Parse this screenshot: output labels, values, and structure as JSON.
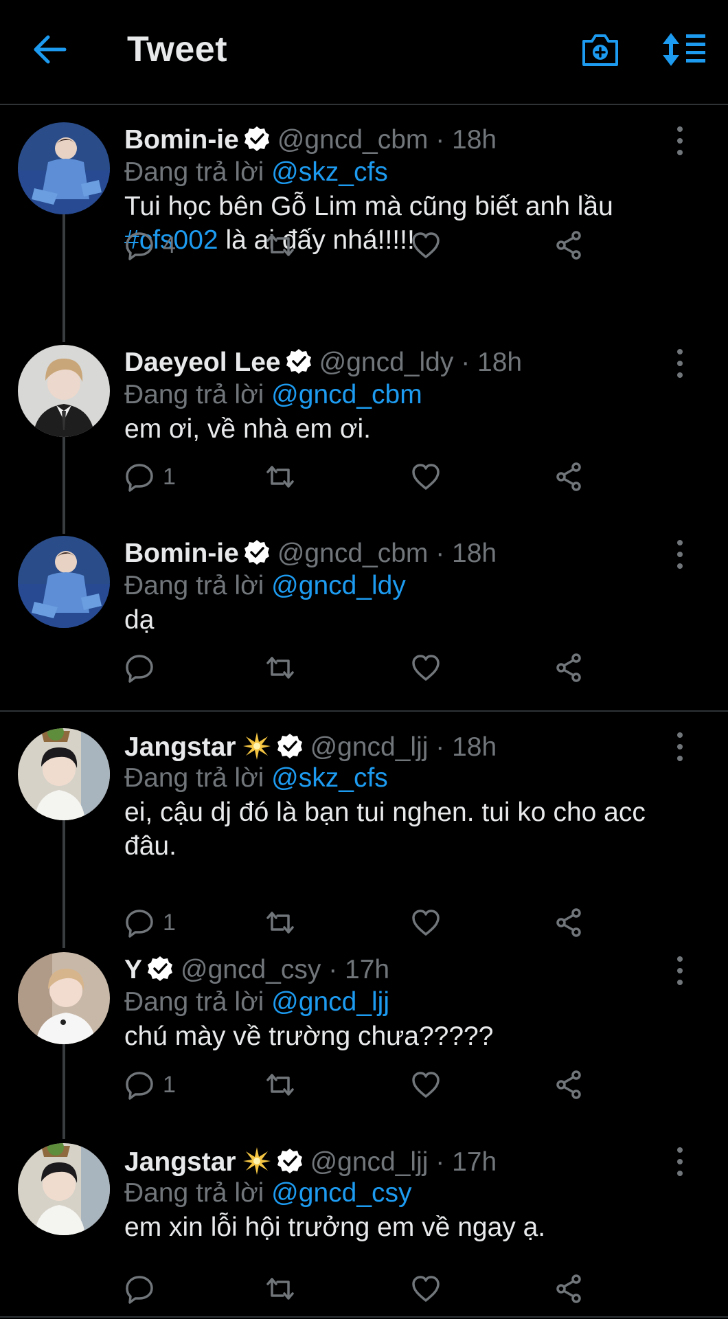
{
  "header": {
    "title": "Tweet"
  },
  "tweets": [
    {
      "name": "Bomin-ie",
      "handle": "@gncd_cbm",
      "time": "· 18h",
      "replying_prefix": "Đang trả lời ",
      "replying_to": "@skz_cfs",
      "text_part1": "Tui học bên Gỗ Lim mà cũng biết anh lầu ",
      "hashtag": "#cfs002",
      "text_part2": " là ai đấy nhá!!!!!",
      "reply_count": "4"
    },
    {
      "name": "Daeyeol Lee",
      "handle": "@gncd_ldy",
      "time": "· 18h",
      "replying_prefix": "Đang trả lời ",
      "replying_to": "@gncd_cbm",
      "text": "em ơi, về nhà em ơi.",
      "reply_count": "1"
    },
    {
      "name": "Bomin-ie",
      "handle": "@gncd_cbm",
      "time": "· 18h",
      "replying_prefix": "Đang trả lời ",
      "replying_to": "@gncd_ldy",
      "text": "dạ",
      "reply_count": ""
    },
    {
      "name": "Jangstar",
      "handle": "@gncd_ljj",
      "time": "· 18h",
      "replying_prefix": "Đang trả lời ",
      "replying_to": "@skz_cfs",
      "text": "ei, cậu dj đó là bạn tui nghen. tui ko cho acc đâu.",
      "reply_count": "1"
    },
    {
      "name": "Y",
      "handle": "@gncd_csy",
      "time": "· 17h",
      "replying_prefix": "Đang trả lời ",
      "replying_to": "@gncd_ljj",
      "text": "chú mày về trường chưa?????",
      "reply_count": "1"
    },
    {
      "name": "Jangstar",
      "handle": "@gncd_ljj",
      "time": "· 17h",
      "replying_prefix": "Đang trả lời ",
      "replying_to": "@gncd_csy",
      "text": "em xin lỗi hội trưởng em về ngay ạ.",
      "reply_count": ""
    }
  ],
  "icons": {
    "back": "back-arrow-icon",
    "camera": "camera-plus-icon",
    "sort": "sort-icon",
    "verified": "verified-badge-icon",
    "sparkle": "sparkle-star-icon",
    "reply": "reply-icon",
    "retweet": "retweet-icon",
    "like": "heart-icon",
    "share": "share-icon",
    "more": "more-vertical-icon"
  },
  "colors": {
    "accent": "#1d9bf0",
    "background": "#000000",
    "muted": "#71767b",
    "text": "#e7e9ea",
    "divider": "#2f3336"
  }
}
